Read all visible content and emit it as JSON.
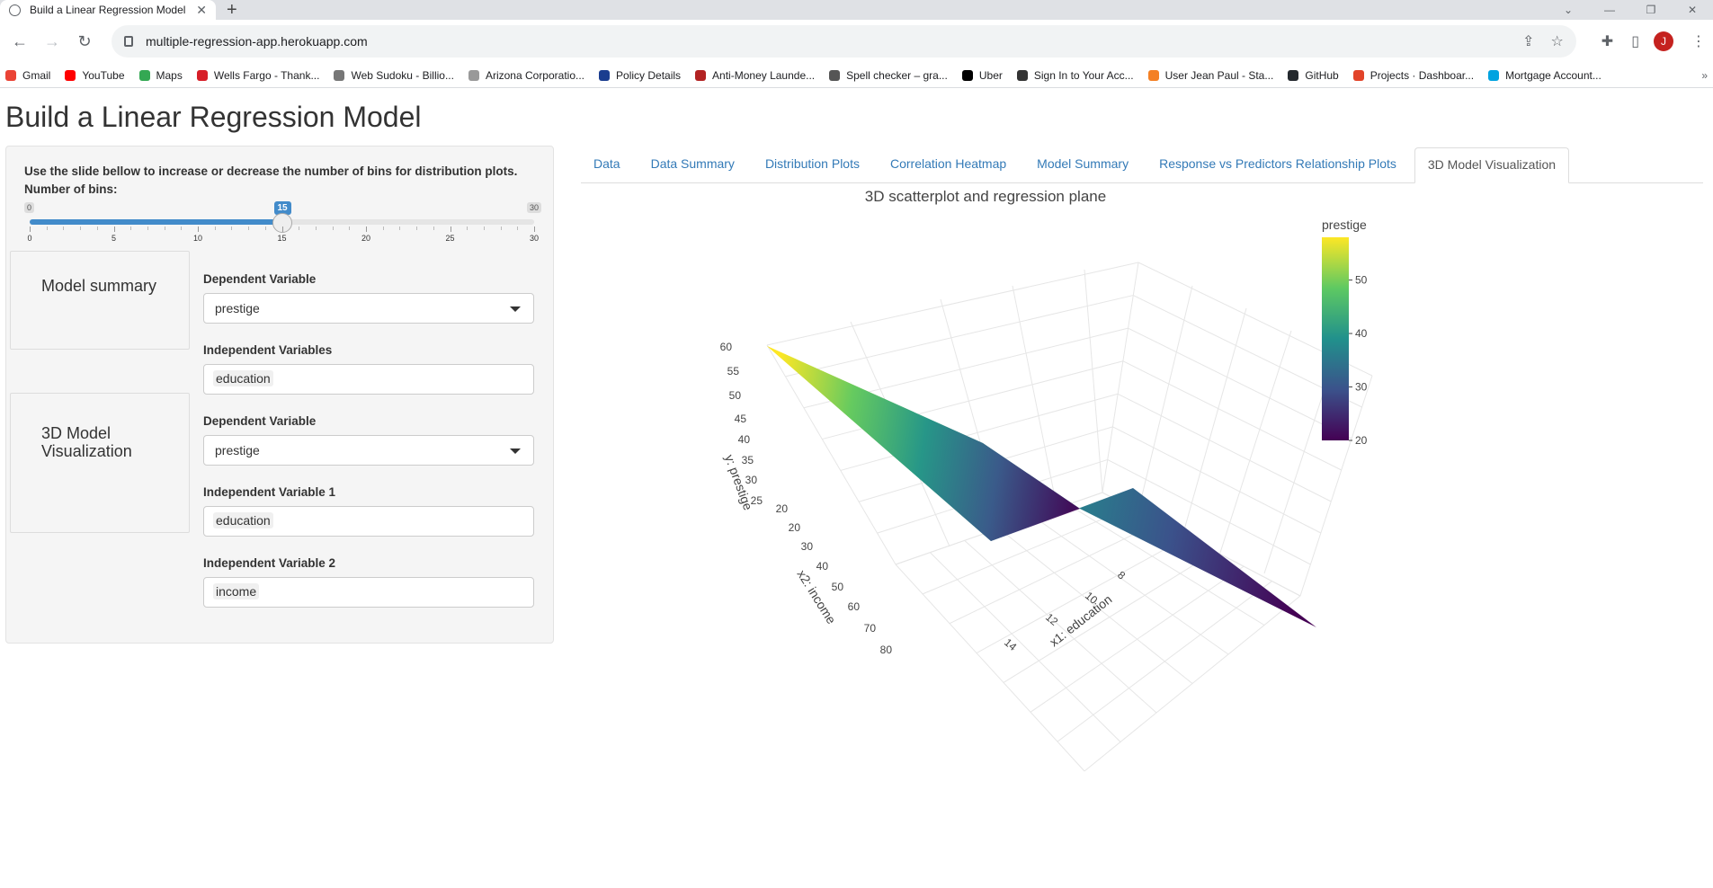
{
  "browser": {
    "tab_title": "Build a Linear Regression Model",
    "new_tab": "+",
    "url": "multiple-regression-app.herokuapp.com",
    "avatar_letter": "J",
    "bookmarks": [
      {
        "label": "Gmail",
        "color": "#ea4335"
      },
      {
        "label": "YouTube",
        "color": "#ff0000"
      },
      {
        "label": "Maps",
        "color": "#34a853"
      },
      {
        "label": "Wells Fargo - Thank...",
        "color": "#d71e28"
      },
      {
        "label": "Web Sudoku - Billio...",
        "color": "#777777"
      },
      {
        "label": "Arizona Corporatio...",
        "color": "#999999"
      },
      {
        "label": "Policy Details",
        "color": "#1a3d8f"
      },
      {
        "label": "Anti-Money Launde...",
        "color": "#b22222"
      },
      {
        "label": "Spell checker – gra...",
        "color": "#555555"
      },
      {
        "label": "Uber",
        "color": "#000000"
      },
      {
        "label": "Sign In to Your Acc...",
        "color": "#333333"
      },
      {
        "label": "User Jean Paul - Sta...",
        "color": "#f48024"
      },
      {
        "label": "GitHub",
        "color": "#24292e"
      },
      {
        "label": "Projects · Dashboar...",
        "color": "#e24329"
      },
      {
        "label": "Mortgage Account...",
        "color": "#00a3e0"
      }
    ],
    "more": "»"
  },
  "page": {
    "title": "Build a Linear Regression Model"
  },
  "sidebar": {
    "slider_instruction": "Use the slide bellow to increase or decrease the number of bins for distribution plots.",
    "slider_label": "Number of bins:",
    "slider": {
      "min": 0,
      "max": 30,
      "value": 15,
      "min_label": "0",
      "max_label": "30",
      "value_label": "15",
      "tick_labels": [
        "0",
        "5",
        "10",
        "15",
        "20",
        "25",
        "30"
      ]
    },
    "model_summary": {
      "card_label": "Model summary",
      "dep_label": "Dependent Variable",
      "dep_value": "prestige",
      "indep_label": "Independent Variables",
      "indep_value": "education"
    },
    "viz": {
      "card_label_1": "3D Model",
      "card_label_2": "Visualization",
      "dep_label": "Dependent Variable",
      "dep_value": "prestige",
      "indep1_label": "Independent Variable 1",
      "indep1_value": "education",
      "indep2_label": "Independent Variable 2",
      "indep2_value": "income"
    }
  },
  "tabs": [
    {
      "label": "Data",
      "active": false
    },
    {
      "label": "Data Summary",
      "active": false
    },
    {
      "label": "Distribution Plots",
      "active": false
    },
    {
      "label": "Correlation Heatmap",
      "active": false
    },
    {
      "label": "Model Summary",
      "active": false
    },
    {
      "label": "Response vs Predictors Relationship Plots",
      "active": false
    },
    {
      "label": "3D Model Visualization",
      "active": true
    }
  ],
  "chart_data": {
    "type": "surface",
    "title": "3D scatterplot and regression plane",
    "z_axis": {
      "label": "y: prestige",
      "ticks": [
        "60",
        "55",
        "50",
        "45",
        "40",
        "35",
        "30",
        "25",
        "20"
      ]
    },
    "x2_axis": {
      "label": "x2: income",
      "ticks": [
        "20",
        "30",
        "40",
        "50",
        "60",
        "70",
        "80"
      ]
    },
    "x1_axis": {
      "label": "x1: education",
      "ticks": [
        "8",
        "10",
        "12",
        "14"
      ]
    },
    "colorbar": {
      "title": "prestige",
      "ticks": [
        "50",
        "40",
        "30",
        "20"
      ],
      "range": [
        20,
        58
      ]
    },
    "colorscale": [
      "#440154",
      "#3b528b",
      "#21918c",
      "#5ec962",
      "#fde725"
    ]
  }
}
